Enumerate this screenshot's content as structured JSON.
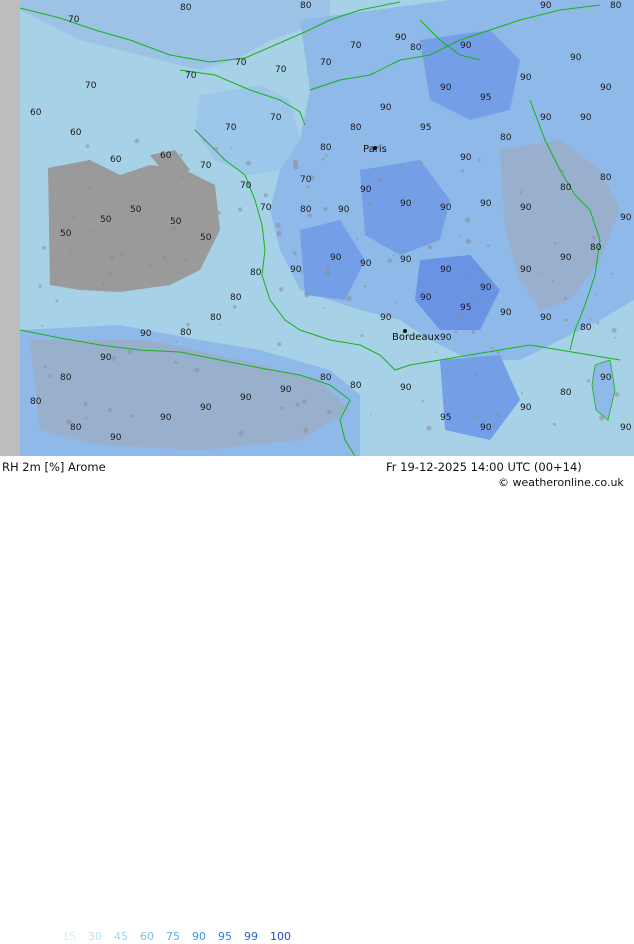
{
  "footer": {
    "title": "RH 2m [%] Arome",
    "datetime": "Fr 19-12-2025 14:00 UTC (00+14)",
    "copyright": "© weatheronline.co.uk"
  },
  "legend": {
    "items": [
      {
        "label": "15",
        "color": "#d7ecf7"
      },
      {
        "label": "30",
        "color": "#bfe0f2"
      },
      {
        "label": "45",
        "color": "#a3d2ee"
      },
      {
        "label": "60",
        "color": "#7cc2ea"
      },
      {
        "label": "75",
        "color": "#5aaee6"
      },
      {
        "label": "90",
        "color": "#3f93e0"
      },
      {
        "label": "95",
        "color": "#2f7ad8"
      },
      {
        "label": "99",
        "color": "#2a62d0"
      },
      {
        "label": "100",
        "color": "#2546b8"
      }
    ]
  },
  "map": {
    "cities": [
      {
        "name": "Paris"
      },
      {
        "name": "Bordeaux"
      }
    ],
    "contour_labels": [
      "70",
      "80",
      "90",
      "95",
      "60",
      "50"
    ],
    "colors": {
      "land_gray": "#9e9e9e",
      "sea": "#a9d3e8",
      "rh_80": "#9cc6ea",
      "rh_90": "#85b3e6",
      "rh_95": "#6f9de6",
      "rh_99": "#5c86e2",
      "coast": "#19b219"
    }
  }
}
